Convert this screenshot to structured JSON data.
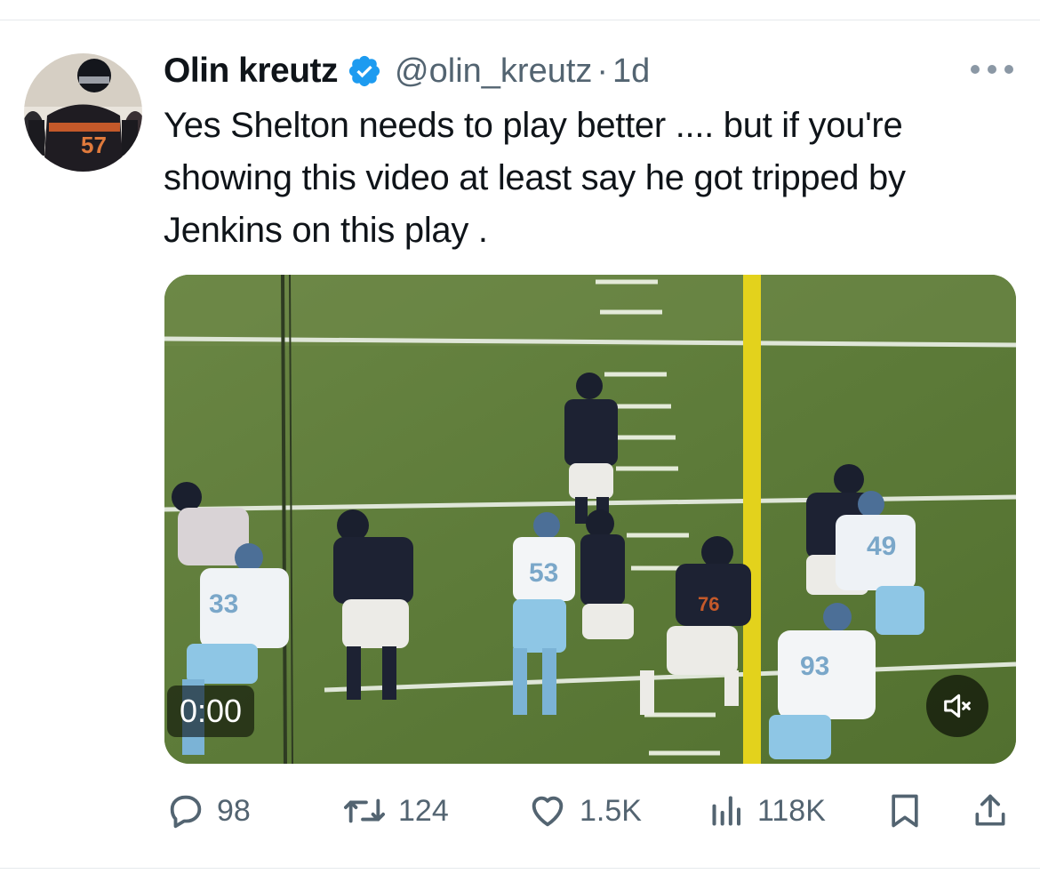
{
  "tweet": {
    "author_name": "Olin kreutz",
    "handle": "@olin_kreutz",
    "separator": "·",
    "time": "1d",
    "text": "Yes Shelton needs to play better .... but if you're showing this video at least say he got tripped by Jenkins on this play .",
    "verified": true,
    "accent_color": "#1d9bf0"
  },
  "media": {
    "type": "video",
    "timestamp": "0:00",
    "muted": true,
    "icons": [
      "mute-icon"
    ]
  },
  "actions": {
    "replies": "98",
    "retweets": "124",
    "likes": "1.5K",
    "views": "118K",
    "icons": [
      "reply-icon",
      "retweet-icon",
      "like-icon",
      "views-icon",
      "bookmark-icon",
      "share-icon"
    ]
  }
}
